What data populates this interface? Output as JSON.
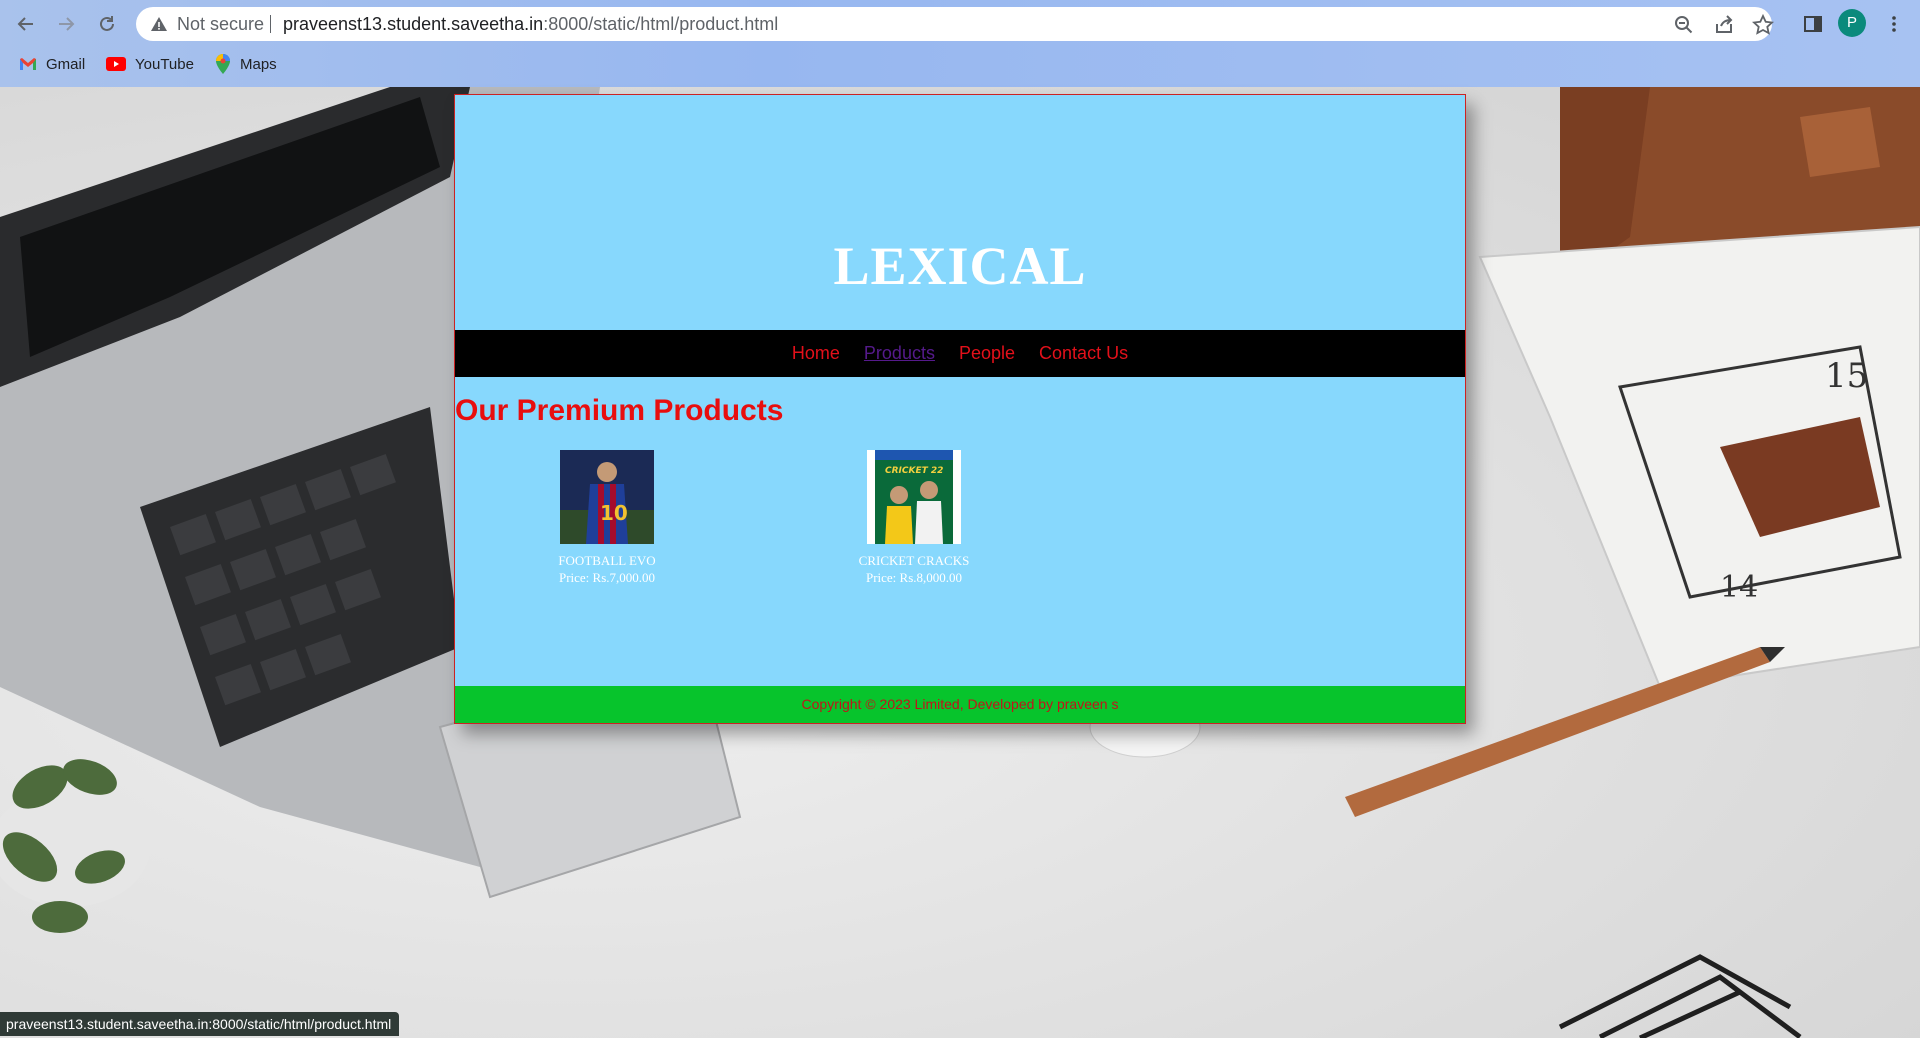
{
  "browser": {
    "omnibox": {
      "security_label": "Not secure",
      "url_host": "praveenst13.student.saveetha.in",
      "url_rest": ":8000/static/html/product.html"
    },
    "profile_initial": "P",
    "bookmarks": [
      {
        "label": "Gmail",
        "icon": "gmail-icon"
      },
      {
        "label": "YouTube",
        "icon": "youtube-icon"
      },
      {
        "label": "Maps",
        "icon": "maps-icon"
      }
    ]
  },
  "page": {
    "site_title": "LEXICAL",
    "nav": {
      "home": "Home",
      "products": "Products",
      "people": "People",
      "contact": "Contact Us"
    },
    "section_title": "Our Premium Products",
    "products": [
      {
        "name": "FOOTBALL EVO",
        "price": "Price: Rs.7,000.00"
      },
      {
        "name": "CRICKET CRACKS",
        "price": "Price: Rs.8,000.00"
      }
    ],
    "footer_text": "Copyright © 2023 Limited, Developed by praveen s"
  },
  "status_url": "praveenst13.student.saveetha.in:8000/static/html/product.html",
  "colors": {
    "page_background": "#87d8fd",
    "nav_link": "#e3101a",
    "nav_link_visited": "#551a8b",
    "footer_background": "#07c42c",
    "heading": "#e80e0e"
  }
}
